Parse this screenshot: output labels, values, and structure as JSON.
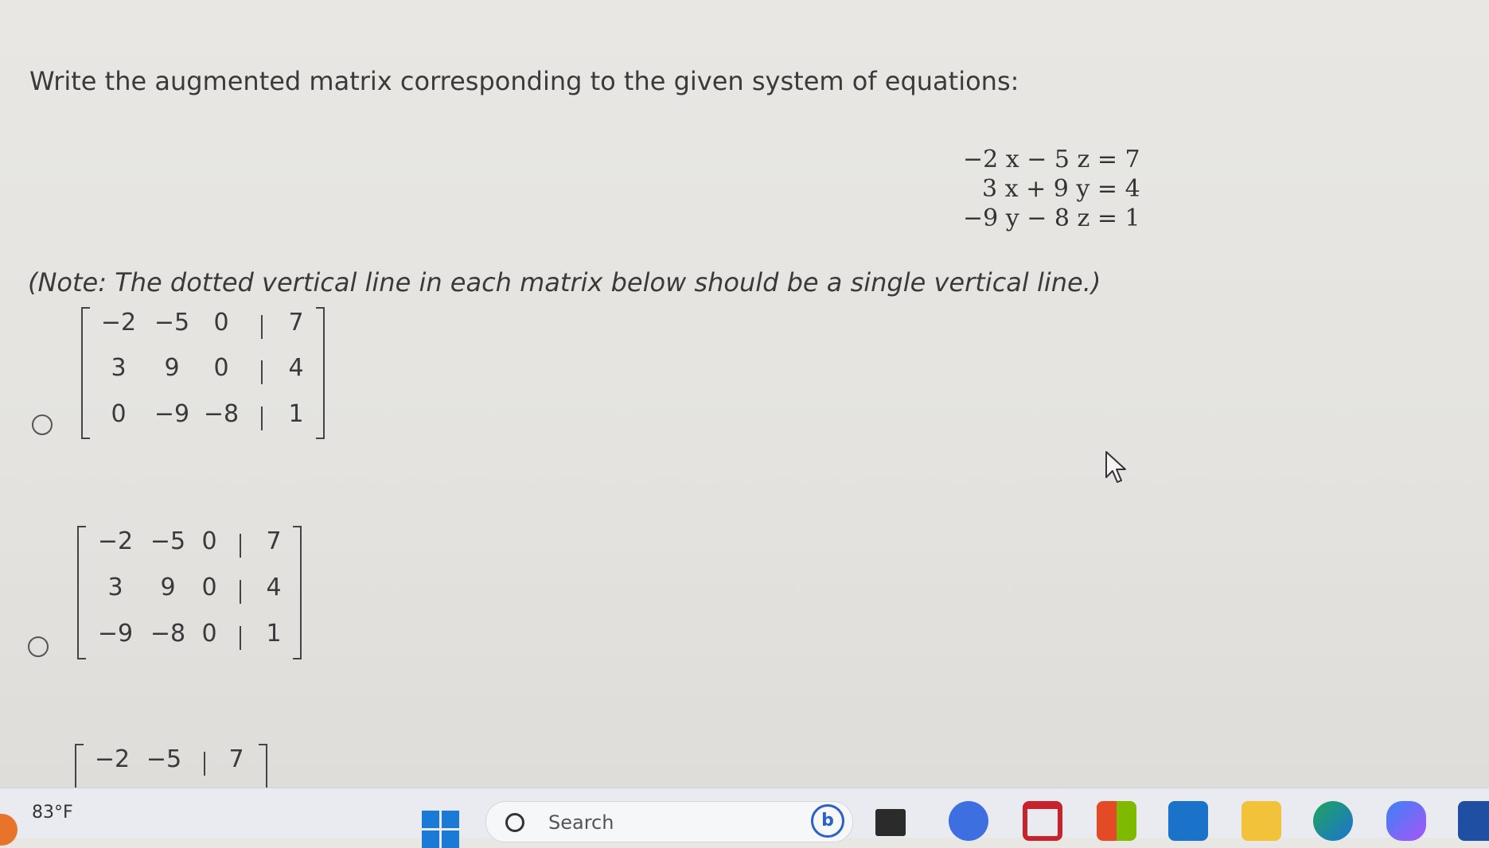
{
  "question": "Write the augmented matrix corresponding to the given system of equations:",
  "equations": [
    "−2 x − 5 z = 7",
    "3 x + 9 y = 4",
    "−9 y − 8 z = 1"
  ],
  "note": "(Note: The dotted vertical line in each matrix below should be a single vertical line.)",
  "options": [
    {
      "rows": [
        [
          "−2",
          "−5",
          "0",
          "7"
        ],
        [
          "3",
          "9",
          "0",
          "4"
        ],
        [
          "0",
          "−9",
          "−8",
          "1"
        ]
      ]
    },
    {
      "rows": [
        [
          "−2",
          "−5",
          "0",
          "7"
        ],
        [
          "3",
          "9",
          "0",
          "4"
        ],
        [
          "−9",
          "−8",
          "0",
          "1"
        ]
      ]
    },
    {
      "rows": [
        [
          "−2",
          "−5",
          "7"
        ]
      ]
    }
  ],
  "taskbar": {
    "weather": "83°F",
    "search_placeholder": "Search",
    "icons": [
      "start-icon",
      "bing-chat-icon",
      "task-view-icon",
      "zoom-icon",
      "gmail-icon",
      "microsoft-store-icon",
      "mail-icon",
      "file-explorer-icon",
      "edge-icon",
      "copilot-icon",
      "word-icon"
    ]
  }
}
